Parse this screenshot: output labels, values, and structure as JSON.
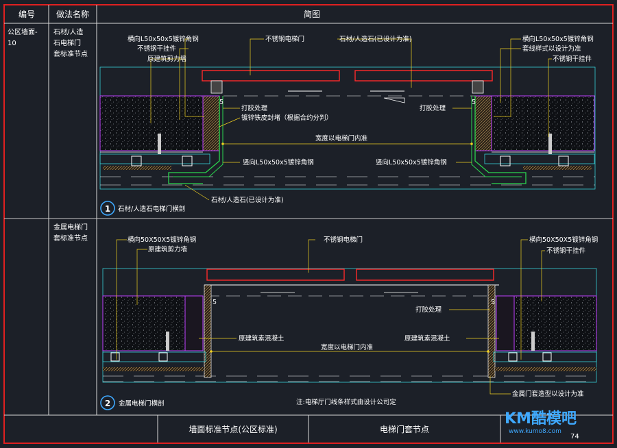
{
  "table": {
    "col_no": "编号",
    "col_method": "做法名称",
    "col_diagram": "简图",
    "row1": {
      "no": [
        "公区墙面-",
        "10"
      ],
      "method": [
        "石材/人造",
        "石电梯门",
        "套标准节点"
      ]
    },
    "row2": {
      "method": [
        "金属电梯门",
        "套标准节点"
      ]
    }
  },
  "detail1": {
    "number": "1",
    "caption": "石材/人造石电梯门横剖",
    "labels": {
      "l_angle_h": "横向L50x50x5镀锌角钢",
      "l_pendant": "不锈钢干挂件",
      "l_wall": "原建筑剪力墙",
      "l_glue": "打胶处理",
      "l_sheet": "镀锌铁皮封堵（根据合约分判）",
      "l_angle_v": "竖向L50x50x5镀锌角钢",
      "l_stone": "石材/人造石(已设计为准)",
      "top_door": "不锈钢电梯门",
      "top_stone": "石材/人造石(已设计为准)",
      "r_angle_h": "横向L50x50x5镀锌角钢",
      "r_trim": "套线样式以设计为准",
      "r_pendant": "不锈钢干挂件",
      "r_glue": "打胶处理",
      "r_angle_v": "竖向L50x50x5镀锌角钢",
      "width": "宽度以电梯门内准",
      "dim5": "5"
    }
  },
  "detail2": {
    "number": "2",
    "caption": "金属电梯门横剖",
    "note": "注:电梯厅门线条样式由设计公司定",
    "labels": {
      "l_angle_h": "横向50X50X5镀锌角钢",
      "l_wall": "原建筑剪力墙",
      "l_concrete": "原建筑素混凝土",
      "top_door": "不锈钢电梯门",
      "r_angle_h": "横向50X50X5镀锌角钢",
      "r_pendant": "不锈钢干挂件",
      "r_glue": "打胶处理",
      "r_concrete": "原建筑素混凝土",
      "r_frame": "金属门套造型以设计为准",
      "width": "宽度以电梯门内准",
      "dim5": "5"
    }
  },
  "footer": {
    "left": "墙面标准节点(公区标准)",
    "right": "电梯门套节点",
    "page": "74"
  },
  "watermark": {
    "brand": "KM酷模吧",
    "url": "www.kumo8.com"
  },
  "colors": {
    "frame": "#e02020",
    "grid": "#d8d8d8",
    "stone": "#2bd64f",
    "door": "#ff2a2a",
    "wall": "#c040ff",
    "leader": "#f0d020",
    "cyan": "#38d0d8"
  }
}
